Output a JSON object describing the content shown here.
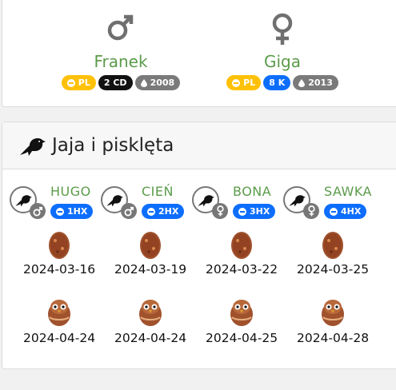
{
  "parents": [
    {
      "sex": "male",
      "sex_icon": "mars-icon",
      "name": "Franek",
      "badges": [
        {
          "icon": "coin-icon",
          "text": "PL",
          "color": "#ffc107"
        },
        {
          "icon": "",
          "text": "2 CD",
          "color": "#111111"
        },
        {
          "icon": "drop-icon",
          "text": "2008",
          "color": "#7a7a7a"
        }
      ]
    },
    {
      "sex": "female",
      "sex_icon": "venus-icon",
      "name": "Giga",
      "badges": [
        {
          "icon": "coin-icon",
          "text": "PL",
          "color": "#ffc107"
        },
        {
          "icon": "",
          "text": "8 K",
          "color": "#0d6efd"
        },
        {
          "icon": "drop-icon",
          "text": "2013",
          "color": "#7a7a7a"
        }
      ]
    }
  ],
  "eggs_section": {
    "icon": "crow-icon",
    "title": "Jaja i pisklęta"
  },
  "chicks": [
    {
      "name": "HUGO",
      "sex": "male",
      "ring": "1HX",
      "egg_date": "2024-03-16",
      "hatch_date": "2024-04-24"
    },
    {
      "name": "CIEŃ",
      "sex": "male",
      "ring": "2HX",
      "egg_date": "2024-03-19",
      "hatch_date": "2024-04-24"
    },
    {
      "name": "BONA",
      "sex": "female",
      "ring": "3HX",
      "egg_date": "2024-03-22",
      "hatch_date": "2024-04-25"
    },
    {
      "name": "SAWKA",
      "sex": "female",
      "ring": "4HX",
      "egg_date": "2024-03-25",
      "hatch_date": "2024-04-28"
    }
  ]
}
